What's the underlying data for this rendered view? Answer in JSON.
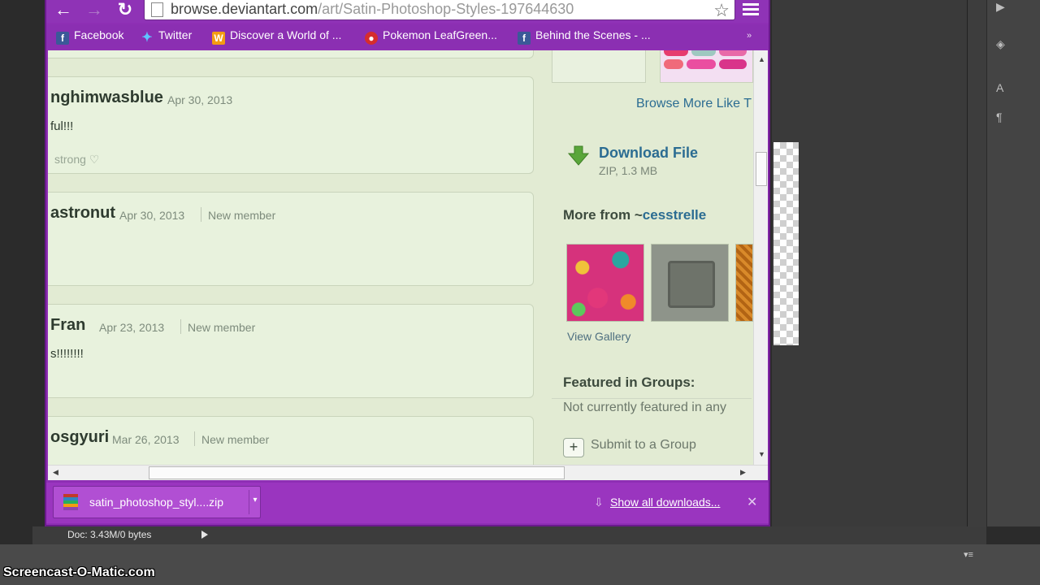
{
  "browser": {
    "url_host": "browse.deviantart.com",
    "url_path": "/art/Satin-Photoshop-Styles-197644630",
    "bookmarks": [
      {
        "label": "Facebook",
        "icon": "facebook-icon"
      },
      {
        "label": "Twitter",
        "icon": "twitter-icon"
      },
      {
        "label": "Discover a World of ...",
        "icon": "wattpad-icon"
      },
      {
        "label": "Pokemon LeafGreen...",
        "icon": "pokeball-icon"
      },
      {
        "label": "Behind the Scenes - ...",
        "icon": "facebook-icon"
      }
    ],
    "bookmarks_more": "»"
  },
  "comments": [
    {
      "name": "nghimwasblue",
      "date": "Apr 30, 2013",
      "member": "",
      "body": "ful!!!",
      "signature": "strong ♡"
    },
    {
      "name": "astronut",
      "date": "Apr 30, 2013",
      "member": "New member",
      "body": "",
      "signature": ""
    },
    {
      "name": "Fran",
      "date": "Apr 23, 2013",
      "member": "New member",
      "body": "s!!!!!!!!",
      "signature": ""
    },
    {
      "name": "osgyuri",
      "date": "Mar 26, 2013",
      "member": "New member",
      "body": "",
      "signature": ""
    }
  ],
  "sidebar": {
    "browse_more": "Browse More Like T",
    "download": {
      "title": "Download File",
      "meta": "ZIP, 1.3 MB"
    },
    "more_from_prefix": "More from ~",
    "more_from_user": "cesstrelle",
    "view_gallery": "View Gallery",
    "featured_title": "Featured in Groups:",
    "not_featured": "Not currently featured in any",
    "submit_group": "Submit to a Group"
  },
  "downloads": {
    "file_name": "satin_photoshop_styl....zip",
    "show_all": "Show all downloads..."
  },
  "photoshop": {
    "doc_info": "Doc: 3.43M/0 bytes"
  },
  "watermark": "Screencast-O-Matic.com"
}
